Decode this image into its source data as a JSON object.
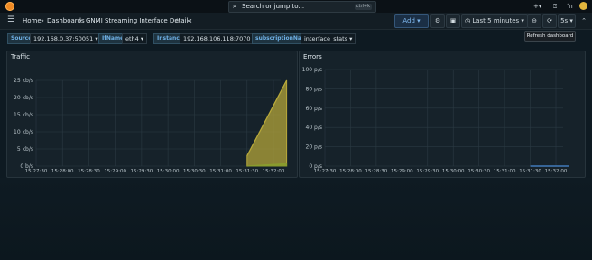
{
  "topbar": {
    "search_placeholder": "Search or jump to...",
    "search_shortcut": "ctrl+k",
    "icons": [
      "grafana-logo-icon",
      "search-icon",
      "plus-icon",
      "help-icon",
      "rss-icon",
      "user-avatar-icon"
    ]
  },
  "nav": {
    "menu_icon": "☰",
    "breadcrumb": [
      "Home",
      "Dashboards",
      "GNMI Streaming Interface Detail"
    ],
    "sep": "›",
    "star": "☆",
    "share": "⋖",
    "toolbar": {
      "add_label": "Add",
      "time_range": "Last 5 minutes",
      "refresh_interval": "5s",
      "refresh_tooltip": "Refresh dashboard"
    }
  },
  "variables": [
    {
      "name": "Source",
      "value": "192.168.0.37:50051"
    },
    {
      "name": "IfName",
      "value": "eth4"
    },
    {
      "name": "Instance",
      "value": "192.168.106.118:7070"
    },
    {
      "name": "subscriptionName",
      "value": "interface_stats"
    }
  ],
  "panels": {
    "traffic": {
      "title": "Traffic",
      "chart_data": {
        "type": "area",
        "title": "Traffic",
        "y_ticks": [
          "0 b/s",
          "5 kb/s",
          "10 kb/s",
          "15 kb/s",
          "20 kb/s",
          "25 kb/s"
        ],
        "x_ticks": [
          "15:27:30",
          "15:28:00",
          "15:28:30",
          "15:29:00",
          "15:29:30",
          "15:30:00",
          "15:30:30",
          "15:31:00",
          "15:31:30",
          "15:32:00"
        ],
        "ylim": [
          0,
          25000
        ],
        "series": [
          {
            "color": "#b8a93a",
            "x": [
              "15:31:30",
              "15:32:15"
            ],
            "values": [
              3000,
              25000
            ]
          },
          {
            "color": "#8a9c2e",
            "x": [
              "15:31:30",
              "15:32:15"
            ],
            "values": [
              0,
              700
            ]
          }
        ]
      }
    },
    "errors": {
      "title": "Errors",
      "chart_data": {
        "type": "line",
        "title": "Errors",
        "y_ticks": [
          "0 p/s",
          "20 p/s",
          "40 p/s",
          "60 p/s",
          "80 p/s",
          "100 p/s"
        ],
        "x_ticks": [
          "15:27:30",
          "15:28:00",
          "15:28:30",
          "15:29:00",
          "15:29:30",
          "15:30:00",
          "15:30:30",
          "15:31:00",
          "15:31:30",
          "15:32:00"
        ],
        "ylim": [
          0,
          100
        ],
        "series": [
          {
            "color": "#4a8bd6",
            "x": [
              "15:31:30",
              "15:32:15"
            ],
            "values": [
              0,
              0
            ]
          }
        ]
      }
    }
  }
}
